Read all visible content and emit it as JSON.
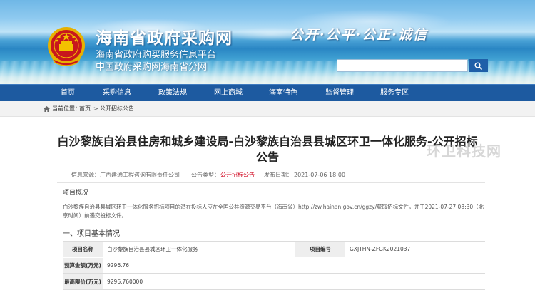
{
  "header": {
    "title": "海南省政府采购网",
    "subtitle1": "海南省政府购买服务信息平台",
    "subtitle2": "中国政府采购网海南省分网",
    "slogan": "公开·公平·公正·诚信",
    "search": {
      "value": "",
      "placeholder": ""
    }
  },
  "nav": {
    "items": [
      {
        "label": "首页"
      },
      {
        "label": "采购信息"
      },
      {
        "label": "政策法规"
      },
      {
        "label": "网上商城"
      },
      {
        "label": "海南特色"
      },
      {
        "label": "监督管理"
      },
      {
        "label": "服务专区"
      }
    ]
  },
  "breadcrumb": {
    "prefix": "当前位置：",
    "home": "首页",
    "separator": ">",
    "current": "公开招标公告"
  },
  "article": {
    "title": "白沙黎族自治县住房和城乡建设局-白沙黎族自治县县城区环卫一体化服务-公开招标公告",
    "meta": {
      "source_label": "信息来源：",
      "source_value": "广西建通工程咨询有限责任公司",
      "type_label": "公告类型：",
      "type_value": "公开招标公告",
      "date_label": "发布日期：",
      "date_value": "2021-07-06 18:00"
    },
    "overview_heading": "项目概况",
    "overview_text": "白沙黎族自治县县城区环卫一体化服务招标项目的潜在投标人应在全国公共资源交易平台（海南省）http://zw.hainan.gov.cn/ggzy/获取招标文件，并于2021-07-27 08:30（北京时间）前递交投标文件。",
    "section1_heading": "一、项目基本情况",
    "table": {
      "rows": [
        {
          "label": "项目名称",
          "value": "白沙黎族自治县县城区环卫一体化服务",
          "label2": "项目编号",
          "value2": "GXJTHN-ZFGK2021037"
        },
        {
          "label": "预算金额(万元)",
          "value": "9296.76"
        },
        {
          "label": "最高限价(万元)",
          "value": "9296.760000"
        }
      ]
    }
  },
  "watermark": "环卫科技网",
  "colors": {
    "nav_bg": "#1d5aa0",
    "accent_red": "#d0021b",
    "search_button": "#1f5fa8"
  },
  "icons": {
    "emblem": "national-emblem-icon",
    "search": "search-icon",
    "home": "home-icon"
  }
}
